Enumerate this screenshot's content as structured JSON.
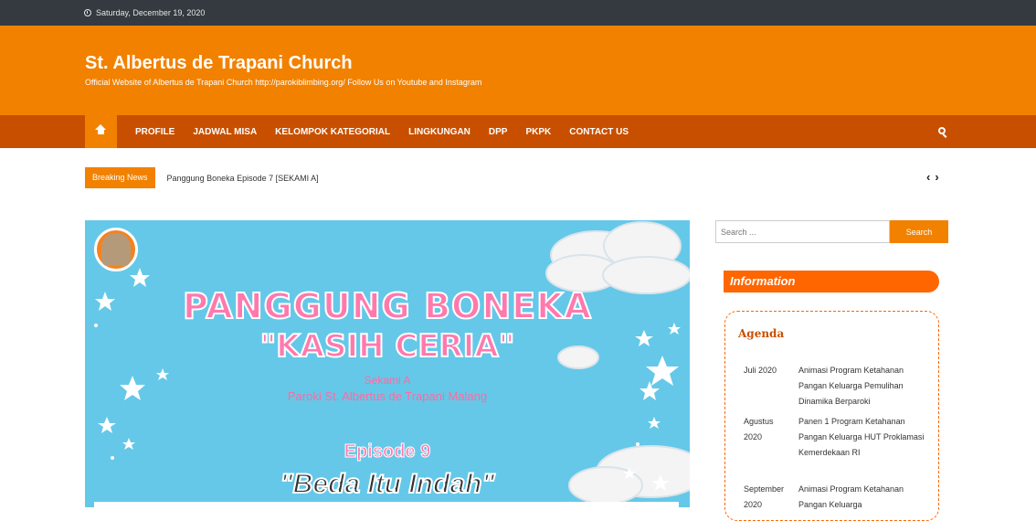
{
  "topbar": {
    "date": "Saturday, December 19, 2020"
  },
  "header": {
    "title": "St. Albertus de Trapani Church",
    "description": "Official Website of Albertus de Trapani Church    http://parokiblimbing.org/    Follow Us on Youtube and Instagram"
  },
  "nav": {
    "items": [
      "PROFILE",
      "JADWAL MISA",
      "KELOMPOK KATEGORIAL",
      "LINGKUNGAN",
      "DPP",
      "PKPK",
      "CONTACT US"
    ]
  },
  "breaking": {
    "label": "Breaking News",
    "headline": "Panggung Boneka Episode 7 [SEKAMI A]"
  },
  "hero": {
    "line1": "PANGGUNG BONEKA",
    "line2": "\"KASIH CERIA\"",
    "line3": "Sekami A",
    "line4": "Paroki St. Albertus de Trapani Malang",
    "line5": "Episode 9",
    "line6": "\"Beda Itu Indah\""
  },
  "sidebar": {
    "search_placeholder": "Search ...",
    "search_button": "Search",
    "info_title": "Information",
    "agenda_title": "Agenda",
    "agenda": [
      {
        "month": "Juli 2020",
        "events": "Animasi Program Ketahanan Pangan Keluarga Pemulihan Dinamika Berparoki"
      },
      {
        "month": "Agustus 2020",
        "events": "Panen 1 Program Ketahanan Pangan Keluarga HUT Proklamasi Kemerdekaan RI"
      },
      {
        "month": "September 2020",
        "events": "Animasi Program Ketahanan Pangan Keluarga"
      }
    ]
  },
  "colors": {
    "accent": "#f28100",
    "nav": "#c84f00",
    "topbar": "#343a40",
    "hero_bg": "#58c4e6"
  }
}
